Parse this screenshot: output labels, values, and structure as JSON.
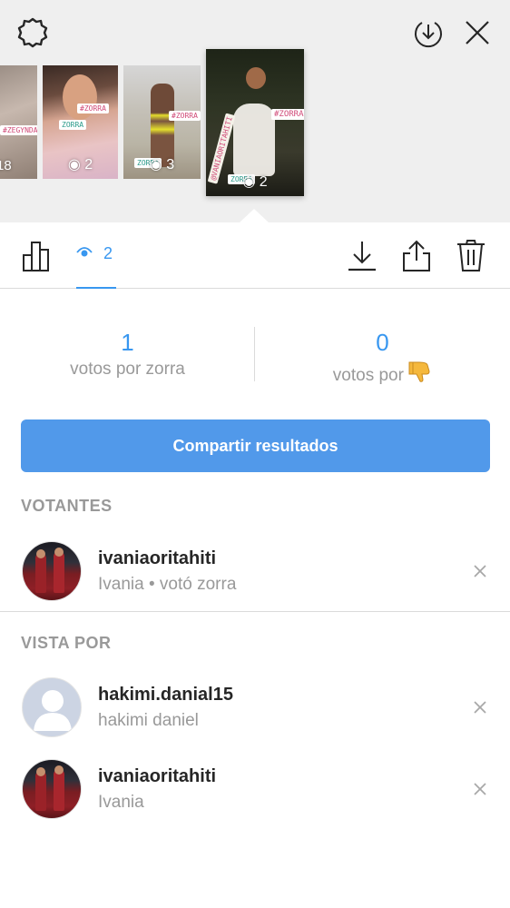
{
  "header": {
    "icons": [
      "settings-gear-icon",
      "download-circle-icon",
      "close-icon"
    ]
  },
  "thumbnails": [
    {
      "views": "18",
      "tags": [
        "#ZEGYNDA"
      ]
    },
    {
      "views": "2",
      "tags": [
        "#ZORRA",
        "ZORRA"
      ]
    },
    {
      "views": "3",
      "tags": [
        "#ZORRA",
        "ZORRA"
      ]
    },
    {
      "views": "2",
      "tags": [
        "#ZORRA",
        "@VANIAORITAHITI",
        "ZORRA"
      ],
      "selected": true
    }
  ],
  "toolbar": {
    "view_count": "2",
    "icons": [
      "stats-icon",
      "eye-icon",
      "download-icon",
      "share-icon",
      "trash-icon"
    ]
  },
  "poll": {
    "left_count": "1",
    "left_label": "votos por zorra",
    "right_count": "0",
    "right_label": "votos por",
    "right_emoji": "thumbs-down"
  },
  "share_button": "Compartir resultados",
  "voters": {
    "heading": "VOTANTES",
    "items": [
      {
        "username": "ivaniaoritahiti",
        "subtitle": "Ivania • votó zorra"
      }
    ]
  },
  "viewers": {
    "heading": "VISTA POR",
    "items": [
      {
        "username": "hakimi.danial15",
        "subtitle": "hakimi daniel"
      },
      {
        "username": "ivaniaoritahiti",
        "subtitle": "Ivania"
      }
    ]
  },
  "colors": {
    "accent": "#3897f0",
    "button": "#5199ea",
    "muted_text": "#999999",
    "top_background": "#efefef"
  }
}
